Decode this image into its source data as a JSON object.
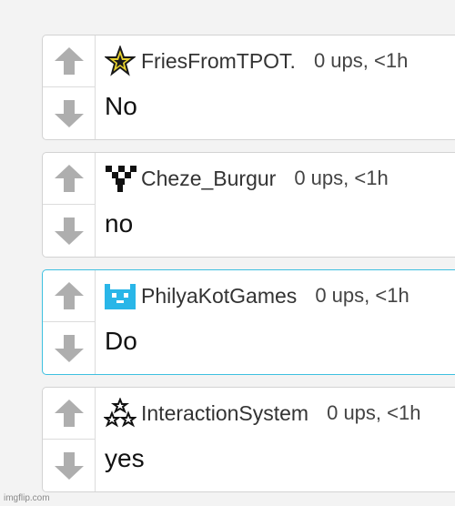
{
  "comments": [
    {
      "username": "FriesFromTPOT.",
      "meta": "0 ups, <1h",
      "text": "No",
      "avatar_icon": "star-icon"
    },
    {
      "username": "Cheze_Burgur",
      "meta": "0 ups, <1h",
      "text": "no",
      "avatar_icon": "pixel-checker-icon"
    },
    {
      "username": "PhilyaKotGames",
      "meta": "0 ups, <1h",
      "text": "Do",
      "avatar_icon": "pixel-cat-icon",
      "highlight_color": "#3ec0e0"
    },
    {
      "username": "InteractionSystem",
      "meta": "0 ups, <1h",
      "text": "yes",
      "avatar_icon": "stars-cluster-icon"
    }
  ],
  "colors": {
    "arrow": "#aeaeae",
    "border": "#d3d3d3",
    "background": "#f3f3f3"
  },
  "watermark": "imgflip.com"
}
